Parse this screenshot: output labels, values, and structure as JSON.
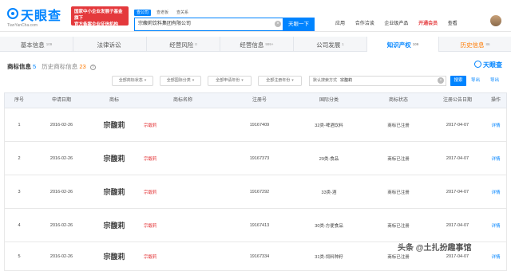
{
  "header": {
    "logo_text": "天眼查",
    "logo_sub": "TianYanCha.com",
    "promo_line1": "国家中小企业发展子基金旗下",
    "promo_line2": "官方备案企业征信机构",
    "search_tabs": [
      "查公司",
      "查老板",
      "查关系"
    ],
    "search_value": "宗馥莉饮料集团有限公司",
    "search_button": "天眼一下",
    "nav": [
      "应用",
      "合作洽谈",
      "企业级产品",
      "开通会员",
      "查看"
    ]
  },
  "tabs": [
    {
      "label": "基本信息",
      "count": "109"
    },
    {
      "label": "法律诉讼",
      "count": ""
    },
    {
      "label": "经营风险",
      "count": "0"
    },
    {
      "label": "经营信息",
      "count": "999+"
    },
    {
      "label": "公司发展",
      "count": "1"
    },
    {
      "label": "知识产权",
      "count": "109"
    },
    {
      "label": "历史信息",
      "count": "86"
    }
  ],
  "section": {
    "title": "商标信息",
    "count": "5",
    "history_label": "历史商标信息",
    "history_count": "23",
    "brand": "天眼查"
  },
  "filters": {
    "items": [
      "全部商标状态",
      "全部国际分类",
      "全部申请年份",
      "全部注册年份"
    ],
    "search_scope": "默认搜索方式",
    "search_value": "宗馥莉",
    "search_button": "搜索",
    "link1": "导出",
    "link2": "导出"
  },
  "table": {
    "headers": [
      "序号",
      "申请日期",
      "商标",
      "商标名称",
      "注册号",
      "国际分类",
      "商标状态",
      "注册公告日期",
      "操作"
    ],
    "rows": [
      {
        "no": "1",
        "date": "2016-02-26",
        "logo": "宗馥莉",
        "name": "宗馥莉",
        "reg": "19167409",
        "cls": "32类-啤酒饮料",
        "status": "商标已注册",
        "pub": "2017-04-07",
        "op": "详情"
      },
      {
        "no": "2",
        "date": "2016-02-26",
        "logo": "宗馥莉",
        "name": "宗馥莉",
        "reg": "19167373",
        "cls": "29类-食品",
        "status": "商标已注册",
        "pub": "2017-04-07",
        "op": "详情"
      },
      {
        "no": "3",
        "date": "2016-02-26",
        "logo": "宗馥莉",
        "name": "宗馥莉",
        "reg": "19167292",
        "cls": "33类-酒",
        "status": "商标已注册",
        "pub": "2017-04-07",
        "op": "详情"
      },
      {
        "no": "4",
        "date": "2016-02-26",
        "logo": "宗馥莉",
        "name": "宗馥莉",
        "reg": "19167413",
        "cls": "30类-方便食品",
        "status": "商标已注册",
        "pub": "2017-04-07",
        "op": "详情"
      },
      {
        "no": "5",
        "date": "2016-02-26",
        "logo": "宗馥莉",
        "name": "宗馥莉",
        "reg": "19167334",
        "cls": "31类-饲料种籽",
        "status": "商标已注册",
        "pub": "2017-04-07",
        "op": "详情"
      }
    ]
  },
  "watermark": "头条 @土扎扮趣事馆"
}
